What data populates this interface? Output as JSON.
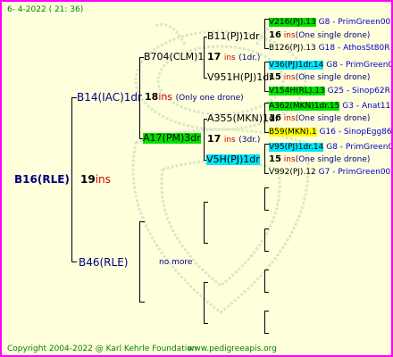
{
  "header": {
    "date": "6-  4-2022 ( 21: 36)"
  },
  "footer": {
    "copyright": "Copyright 2004-2022 @ Karl Kehrle Foundation",
    "website": "www.pedigreeapis.org"
  },
  "root": {
    "name": "B16(RLE)",
    "ins_num": "19",
    "ins_label": "ins"
  },
  "gen1": {
    "sire": {
      "name": "B14(IAC)1dr",
      "ins_num": "18",
      "ins_label": "ins",
      "note": "(Only one drone)"
    },
    "dam": {
      "name": "B46(RLE)",
      "note": "no more"
    }
  },
  "gen2": {
    "a": {
      "name": "B704(CLM)1",
      "ins_num": "17",
      "ins_label": "ins",
      "note": "(1dr.)"
    },
    "b": {
      "name": "A17(PM)3dr",
      "ins_num": "17",
      "ins_label": "ins",
      "note": "(3dr.)"
    }
  },
  "gen3": {
    "a": {
      "name": "B11(PJ)1dr"
    },
    "b": {
      "name": "V951H(PJ)1dr"
    },
    "c": {
      "name": "A355(MKN)1dr"
    },
    "d": {
      "name": "V5H(PJ)1dr"
    }
  },
  "gen4": [
    {
      "name": "V216(PJ).13",
      "gen": "G8",
      "breeder": "- PrimGreen00"
    },
    {
      "ins": "16",
      "ins_label": "ins",
      "note": "(One single drone)"
    },
    {
      "name": "B126(PJ).13",
      "gen": "G18",
      "breeder": "- AthosSt80R"
    },
    {
      "name": "V36(PJ)1dr.14",
      "gen": "G8",
      "breeder": "- PrimGreen00"
    },
    {
      "ins": "15",
      "ins_label": "ins",
      "note": "(One single drone)"
    },
    {
      "name": "V154H(RL).13",
      "gen": "G25",
      "breeder": "- Sinop62R"
    },
    {
      "name": "A362(MKN)1dr.15",
      "gen": "G3",
      "breeder": "- Anat11Q"
    },
    {
      "ins": "16",
      "ins_label": "ins",
      "note": "(One single drone)"
    },
    {
      "name": "B59(MKN).1",
      "gen": "G16",
      "breeder": "- SinopEgg86R"
    },
    {
      "name": "V95(PJ)1dr.14",
      "gen": "G8",
      "breeder": "- PrimGreen00"
    },
    {
      "ins": "15",
      "ins_label": "ins",
      "note": "(One single drone)"
    },
    {
      "name": "V992(PJ).12",
      "gen": "G7",
      "breeder": "- PrimGreen00"
    }
  ],
  "colors": {
    "border": "#ff00ff",
    "background": "#ffffdc",
    "highlight_green": "#00e000",
    "highlight_cyan": "#00e6ff",
    "highlight_yellow": "#ffff00"
  }
}
